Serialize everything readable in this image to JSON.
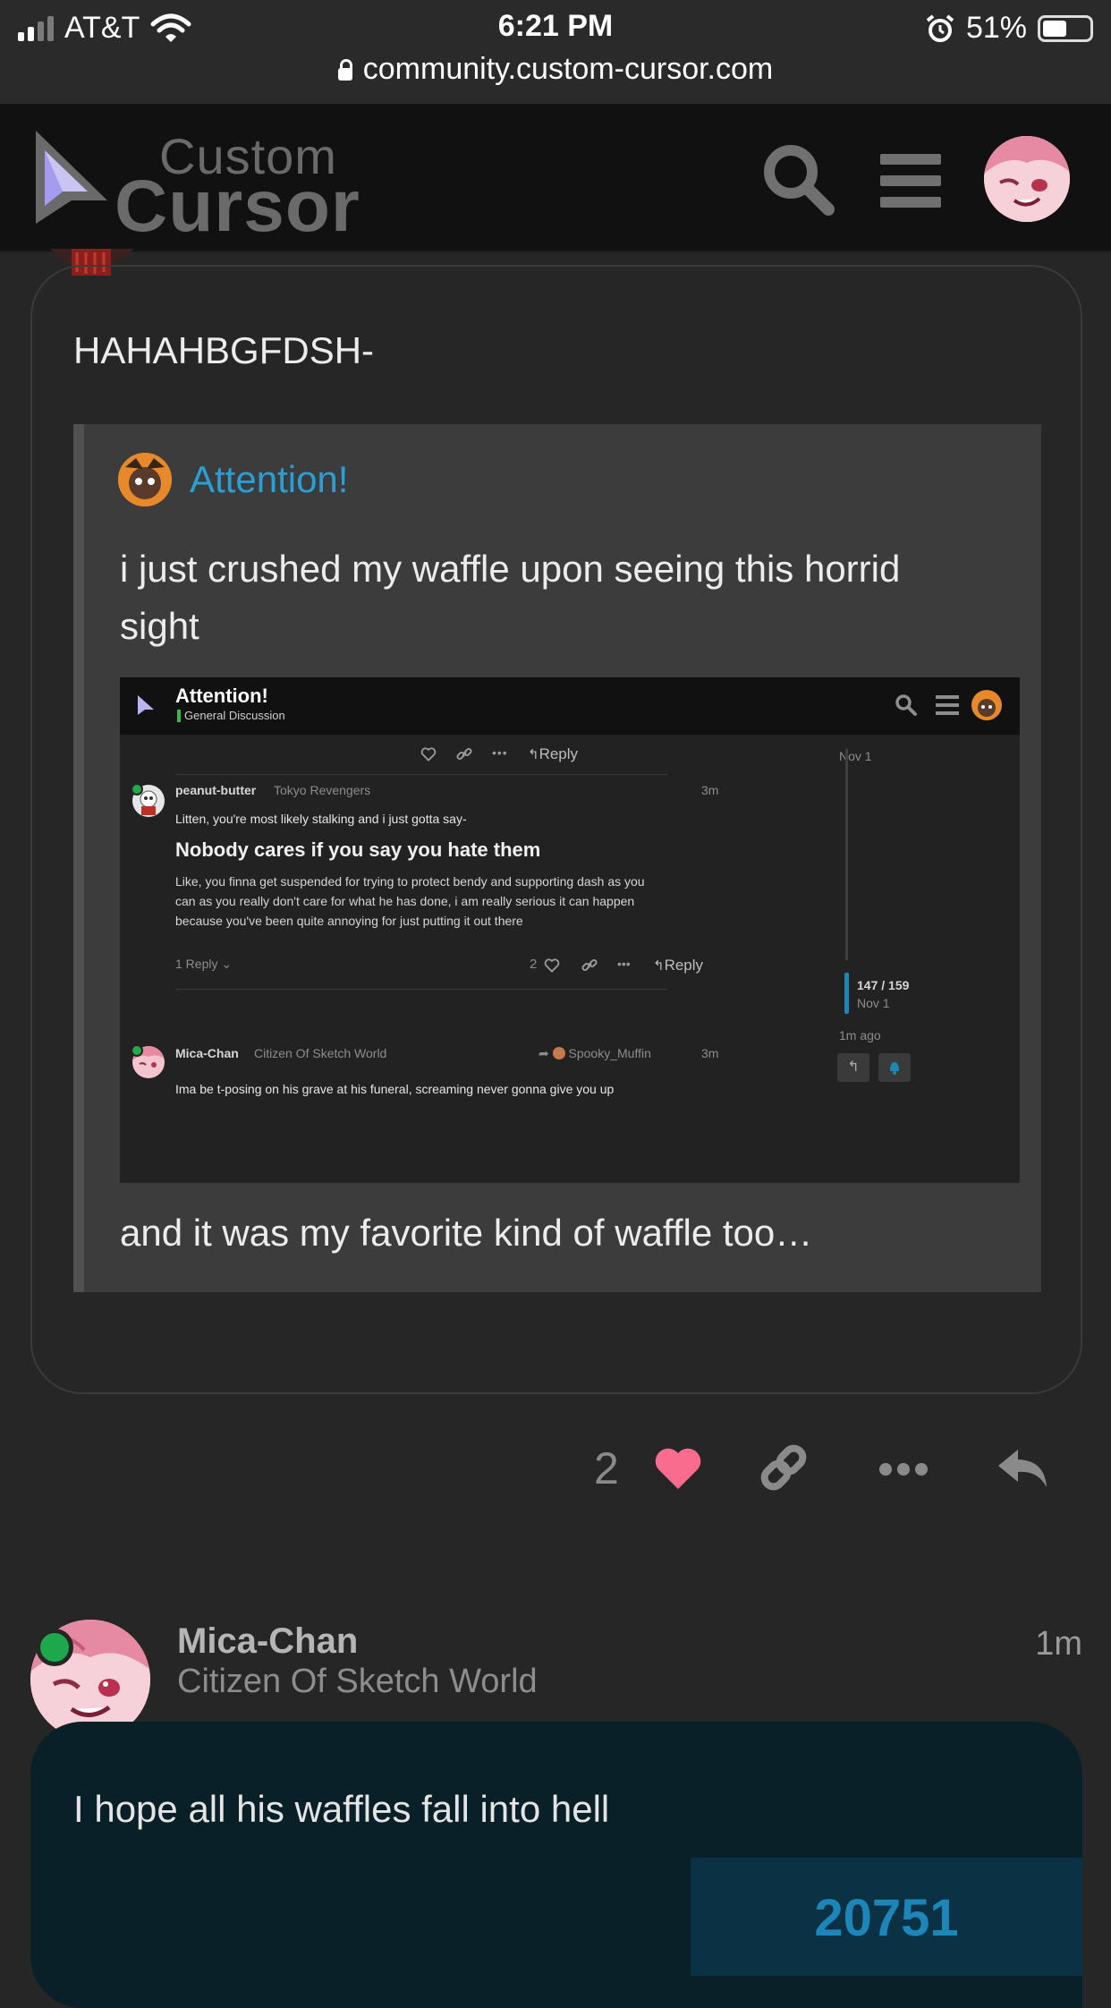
{
  "status_bar": {
    "carrier": "AT&T",
    "time": "6:21 PM",
    "battery": "51%",
    "battery_level": 0.51
  },
  "browser": {
    "url": "community.custom-cursor.com"
  },
  "header": {
    "logo_line1": "Custom",
    "logo_line2": "Cursor"
  },
  "post1": {
    "text": "HAHAHBGFDSH-",
    "quote": {
      "title": "Attention!",
      "body": "i just crushed my waffle upon seeing this horrid sight",
      "footer": "and it was my favorite kind of waffle too…",
      "screenshot": {
        "topic_title": "Attention!",
        "category": "General Discussion",
        "reply_label": "Reply",
        "date1": "Nov 1",
        "post_a": {
          "user": "peanut-butter",
          "flair": "Tokyo Revengers",
          "time": "3m",
          "line1": "Litten, you're most likely stalking and i just gotta say-",
          "heading": "Nobody cares if you say you hate them",
          "body_line1": "Like, you finna get suspended for trying to protect bendy and supporting dash as you",
          "body_line2": "can as you really don't care for what he has done, i am really serious it can happen",
          "body_line3": "because you've been quite annoying for just putting it out there",
          "replies": "1 Reply",
          "likes": "2"
        },
        "progress": "147 / 159",
        "date2": "Nov 1",
        "ago": "1m ago",
        "post_b": {
          "user": "Mica-Chan",
          "flair": "Citizen Of Sketch World",
          "reply_to": "Spooky_Muffin",
          "time": "3m",
          "text": "Ima be t-posing on his grave at his funeral, screaming never gonna give you up"
        }
      }
    },
    "like_count": "2"
  },
  "post2": {
    "user": "Mica-Chan",
    "user_title": "Citizen Of Sketch World",
    "time": "1m",
    "text": "I hope all his waffles fall into hell",
    "badge": "20751"
  },
  "colors": {
    "link": "#2a9fd6",
    "heart": "#fa6c8d",
    "online": "#1da84d",
    "accent": "#1d86b9"
  }
}
